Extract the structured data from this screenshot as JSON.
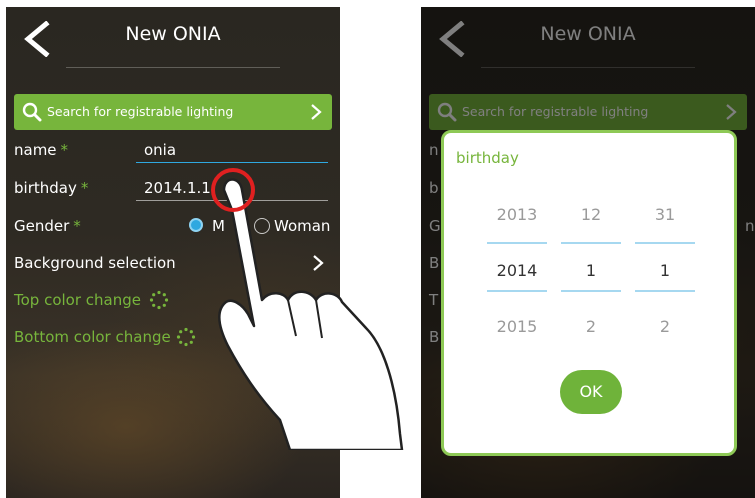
{
  "left_screen": {
    "title": "New ONIA",
    "search_label": "Search for registrable lighting",
    "name_label": "name",
    "name_value": "onia",
    "birthday_label": "birthday",
    "birthday_value": "2014.1.1",
    "gender_label": "Gender",
    "required_mark": "*",
    "gender_options": [
      "M",
      "Woman"
    ],
    "gender_selected": "M",
    "background_label": "Background selection",
    "top_color_label": "Top color change",
    "bottom_color_label": "Bottom color change"
  },
  "right_screen": {
    "title": "New ONIA",
    "search_label": "Search for registrable lighting",
    "peek_letters": [
      "n",
      "b",
      "G",
      "B",
      "T",
      "B"
    ],
    "peek_right": "n"
  },
  "dialog": {
    "title": "birthday",
    "year": {
      "prev": "2013",
      "selected": "2014",
      "next": "2015"
    },
    "month": {
      "prev": "12",
      "selected": "1",
      "next": "2"
    },
    "day": {
      "prev": "31",
      "selected": "1",
      "next": "2"
    },
    "ok_label": "OK"
  },
  "colors": {
    "accent_green": "#77b53c",
    "dialog_border": "#8ec956",
    "radio_blue": "#2fa8e0",
    "underline_blue": "#2fa8e0",
    "touch_ring_red": "#e02020"
  }
}
